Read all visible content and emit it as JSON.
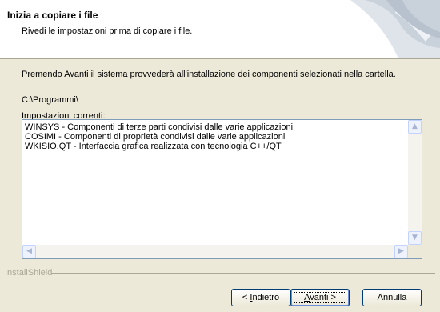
{
  "header": {
    "title": "Inizia a copiare i file",
    "subtitle": "Rivedi le impostazioni prima di copiare i file."
  },
  "body": {
    "intro": "Premendo Avanti il sistema provvederà all'installazione dei componenti selezionati nella cartella.",
    "path": "C:\\Programmi\\",
    "settings_label": "Impostazioni correnti:"
  },
  "listbox": {
    "lines": [
      "WINSYS - Componenti di terze parti condivisi dalle varie applicazioni",
      "COSIMI - Componenti di proprietà condivisi dalle varie applicazioni",
      "WKISIO.QT - Interfaccia grafica realizzata con tecnologia C++/QT"
    ]
  },
  "footer": {
    "brand": "InstallShield"
  },
  "buttons": {
    "back": {
      "prefix": "< ",
      "accel": "I",
      "rest": "ndietro"
    },
    "next": {
      "accel": "A",
      "rest": "vanti >"
    },
    "cancel": "Annulla"
  },
  "colors": {
    "dialog_bg": "#ece9d8",
    "header_bg": "#ffffff",
    "list_border": "#7f9db9",
    "button_border": "#003c74"
  }
}
